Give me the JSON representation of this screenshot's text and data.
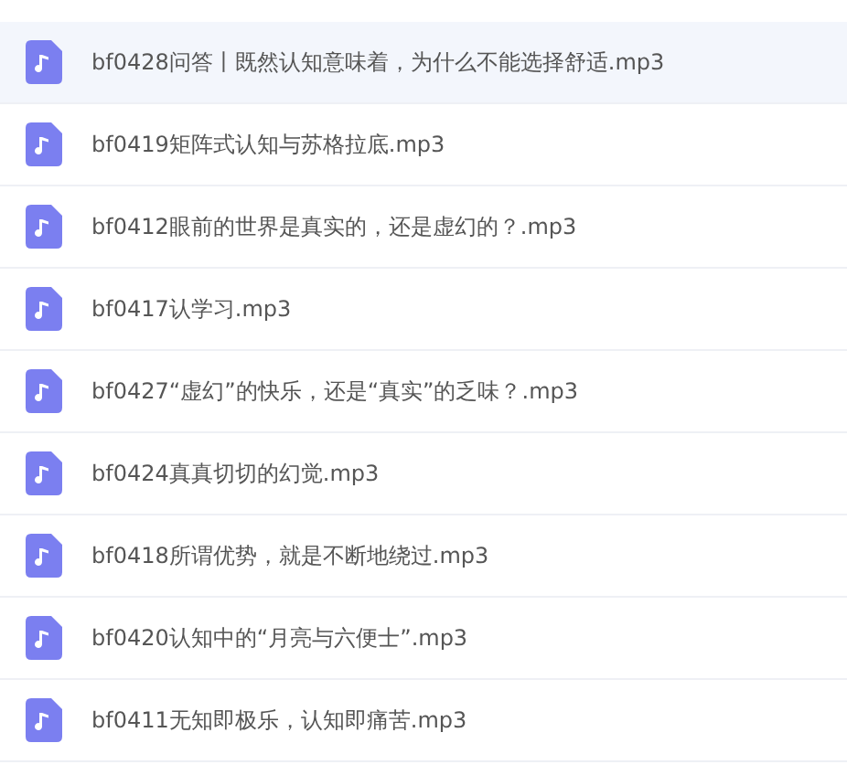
{
  "files": [
    {
      "name": "bf0428问答丨既然认知意味着，为什么不能选择舒适.mp3",
      "selected": true
    },
    {
      "name": "bf0419矩阵式认知与苏格拉底.mp3",
      "selected": false
    },
    {
      "name": "bf0412眼前的世界是真实的，还是虚幻的？.mp3",
      "selected": false
    },
    {
      "name": "bf0417认学习.mp3",
      "selected": false
    },
    {
      "name": "bf0427“虚幻”的快乐，还是“真实”的乏味？.mp3",
      "selected": false
    },
    {
      "name": "bf0424真真切切的幻觉.mp3",
      "selected": false
    },
    {
      "name": "bf0418所谓优势，就是不断地绕过.mp3",
      "selected": false
    },
    {
      "name": "bf0420认知中的“月亮与六便士”.mp3",
      "selected": false
    },
    {
      "name": "bf0411无知即极乐，认知即痛苦.mp3",
      "selected": false
    }
  ]
}
